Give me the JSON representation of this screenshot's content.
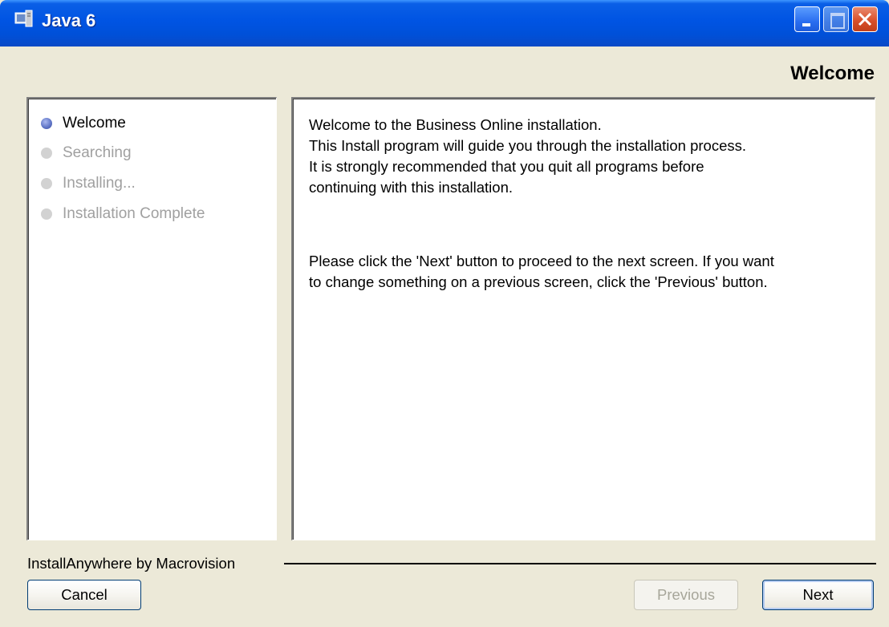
{
  "window": {
    "title": "Java 6",
    "title_icon": "installer-icon",
    "controls": [
      "minimize-icon",
      "maximize-icon",
      "close-icon"
    ]
  },
  "header": {
    "title": "Welcome"
  },
  "steps": [
    {
      "label": "Welcome",
      "state": "active"
    },
    {
      "label": "Searching",
      "state": "inactive"
    },
    {
      "label": "Installing...",
      "state": "inactive"
    },
    {
      "label": "Installation Complete",
      "state": "inactive"
    }
  ],
  "content": {
    "lines": [
      "Welcome to the Business Online installation.",
      "This Install program will guide you through the installation process.",
      "It is strongly recommended that you quit all programs before",
      "continuing with this installation.",
      "Please click the 'Next' button to proceed to the next screen. If you want",
      "to change something on a previous screen, click the 'Previous' button."
    ]
  },
  "footer": {
    "vendor": "InstallAnywhere by Macrovision",
    "cancel_label": "Cancel",
    "previous_label": "Previous",
    "next_label": "Next",
    "previous_enabled": false
  },
  "colors": {
    "titlebar": "#0054e3",
    "window_bg": "#ece9d8",
    "active_dot": "#6277c8",
    "inactive_text": "#a0a0a0"
  }
}
